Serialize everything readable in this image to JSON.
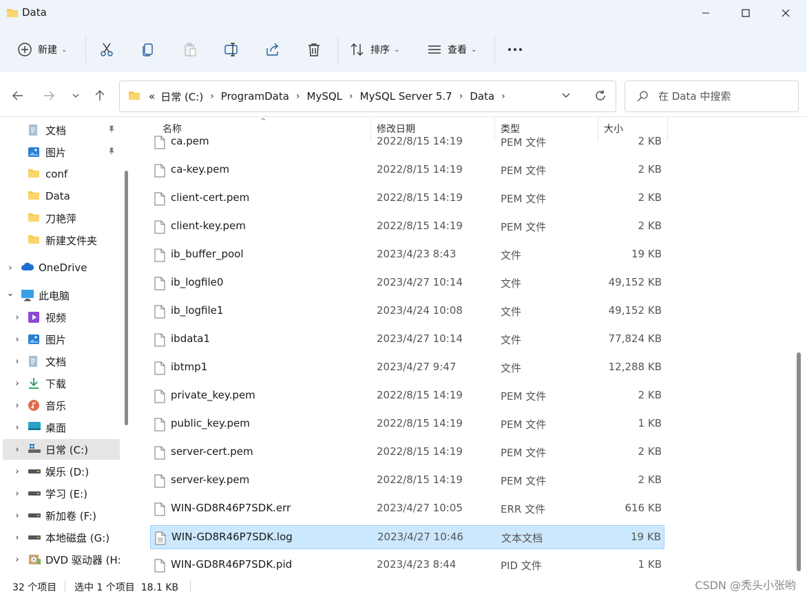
{
  "window": {
    "title": "Data"
  },
  "toolbar": {
    "new_label": "新建",
    "sort_label": "排序",
    "view_label": "查看"
  },
  "address": {
    "crumbs": [
      "日常 (C:)",
      "ProgramData",
      "MySQL",
      "MySQL Server 5.7",
      "Data"
    ],
    "overflow": "«"
  },
  "search": {
    "placeholder": "在 Data 中搜索"
  },
  "sidebar": {
    "items": [
      {
        "label": "文档",
        "icon": "document-icon",
        "pinned": true
      },
      {
        "label": "图片",
        "icon": "pictures-icon",
        "pinned": true
      },
      {
        "label": "conf",
        "icon": "folder-icon"
      },
      {
        "label": "Data",
        "icon": "folder-icon"
      },
      {
        "label": "刀艳萍",
        "icon": "folder-icon"
      },
      {
        "label": "新建文件夹",
        "icon": "folder-icon"
      },
      {
        "label": "OneDrive",
        "icon": "onedrive-icon"
      },
      {
        "label": "此电脑",
        "icon": "computer-icon"
      },
      {
        "label": "视频",
        "icon": "videos-icon"
      },
      {
        "label": "图片",
        "icon": "pictures-icon"
      },
      {
        "label": "文档",
        "icon": "document-icon"
      },
      {
        "label": "下载",
        "icon": "download-icon"
      },
      {
        "label": "音乐",
        "icon": "music-icon"
      },
      {
        "label": "桌面",
        "icon": "desktop-icon"
      },
      {
        "label": "日常 (C:)",
        "icon": "windows-drive-icon"
      },
      {
        "label": "娱乐 (D:)",
        "icon": "drive-icon"
      },
      {
        "label": "学习 (E:)",
        "icon": "drive-icon"
      },
      {
        "label": "新加卷 (F:)",
        "icon": "drive-icon"
      },
      {
        "label": "本地磁盘 (G:)",
        "icon": "drive-icon"
      },
      {
        "label": "DVD 驱动器 (H:)",
        "icon": "dvd-drive-icon"
      }
    ]
  },
  "columns": {
    "name": "名称",
    "date": "修改日期",
    "type": "类型",
    "size": "大小"
  },
  "files": [
    {
      "name": "ca.pem",
      "date": "2022/8/15 14:19",
      "type": "PEM 文件",
      "size": "2 KB"
    },
    {
      "name": "ca-key.pem",
      "date": "2022/8/15 14:19",
      "type": "PEM 文件",
      "size": "2 KB"
    },
    {
      "name": "client-cert.pem",
      "date": "2022/8/15 14:19",
      "type": "PEM 文件",
      "size": "2 KB"
    },
    {
      "name": "client-key.pem",
      "date": "2022/8/15 14:19",
      "type": "PEM 文件",
      "size": "2 KB"
    },
    {
      "name": "ib_buffer_pool",
      "date": "2023/4/23 8:43",
      "type": "文件",
      "size": "19 KB"
    },
    {
      "name": "ib_logfile0",
      "date": "2023/4/27 10:14",
      "type": "文件",
      "size": "49,152 KB"
    },
    {
      "name": "ib_logfile1",
      "date": "2023/4/24 10:08",
      "type": "文件",
      "size": "49,152 KB"
    },
    {
      "name": "ibdata1",
      "date": "2023/4/27 10:14",
      "type": "文件",
      "size": "77,824 KB"
    },
    {
      "name": "ibtmp1",
      "date": "2023/4/27 9:47",
      "type": "文件",
      "size": "12,288 KB"
    },
    {
      "name": "private_key.pem",
      "date": "2022/8/15 14:19",
      "type": "PEM 文件",
      "size": "2 KB"
    },
    {
      "name": "public_key.pem",
      "date": "2022/8/15 14:19",
      "type": "PEM 文件",
      "size": "1 KB"
    },
    {
      "name": "server-cert.pem",
      "date": "2022/8/15 14:19",
      "type": "PEM 文件",
      "size": "2 KB"
    },
    {
      "name": "server-key.pem",
      "date": "2022/8/15 14:19",
      "type": "PEM 文件",
      "size": "2 KB"
    },
    {
      "name": "WIN-GD8R46P7SDK.err",
      "date": "2023/4/27 10:05",
      "type": "ERR 文件",
      "size": "616 KB"
    },
    {
      "name": "WIN-GD8R46P7SDK.log",
      "date": "2023/4/27 10:46",
      "type": "文本文档",
      "size": "19 KB",
      "selected": true
    },
    {
      "name": "WIN-GD8R46P7SDK.pid",
      "date": "2023/4/23 8:44",
      "type": "PID 文件",
      "size": "1 KB"
    }
  ],
  "status": {
    "count": "32 个项目",
    "selection": "选中 1 个项目  18.1 KB"
  },
  "watermark": "CSDN @秃头小张哟",
  "colors": {
    "accent": "#0067c0",
    "selection": "#cce8ff",
    "folder": "#f8c74a"
  }
}
